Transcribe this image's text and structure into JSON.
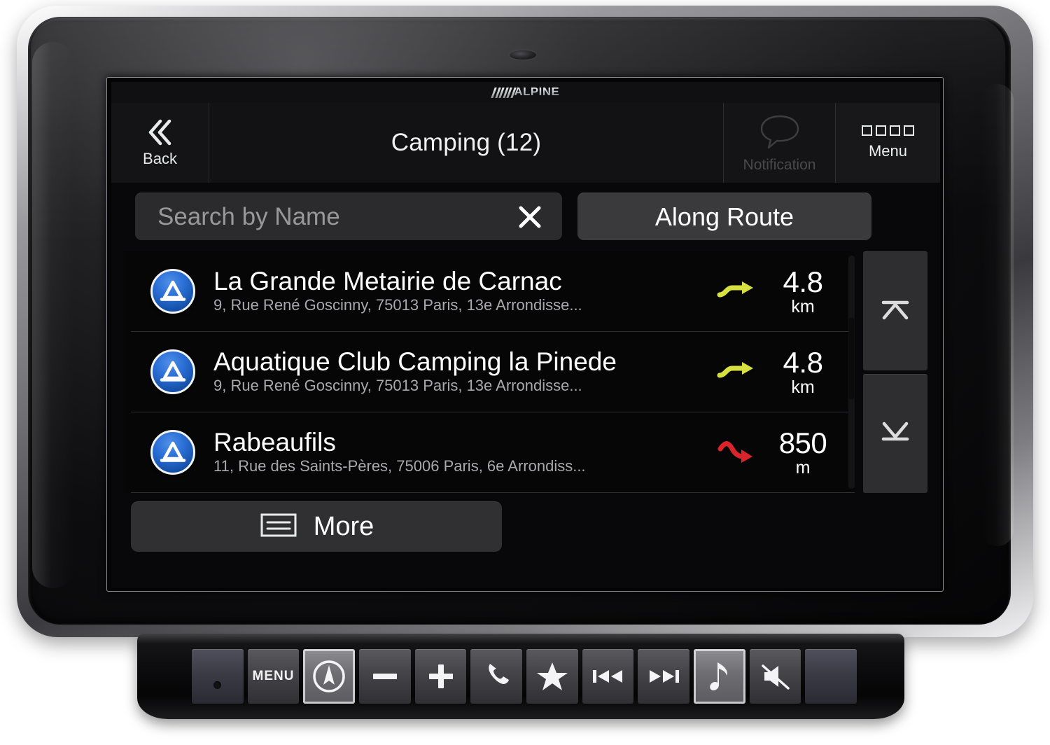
{
  "device": {
    "brand_logo": "ALPINE",
    "sensor": "ir-sensor"
  },
  "header": {
    "back_label": "Back",
    "back_icon": "double-chevron-left-icon",
    "title": "Camping (12)",
    "notification_label": "Notification",
    "notification_icon": "speech-bubble-icon",
    "notification_enabled": false,
    "menu_label": "Menu",
    "menu_icon": "four-squares-icon"
  },
  "search": {
    "placeholder": "Search by Name",
    "value": "",
    "clear_icon": "close-x-icon",
    "along_route_label": "Along Route"
  },
  "list": {
    "poi_icon": "camping-tent-icon",
    "rows": [
      {
        "name": "La Grande Metairie de Carnac",
        "address": "9, Rue René Goscinny, 75013 Paris, 13e Arrondisse...",
        "distance_value": "4.8",
        "distance_unit": "km",
        "direction_icon": "arrow-ahead-icon",
        "direction_color": "#d8e040"
      },
      {
        "name": "Aquatique Club Camping la Pinede",
        "address": "9, Rue René Goscinny, 75013 Paris, 13e Arrondisse...",
        "distance_value": "4.8",
        "distance_unit": "km",
        "direction_icon": "arrow-ahead-icon",
        "direction_color": "#d8e040"
      },
      {
        "name": "Rabeaufils",
        "address": "11, Rue des Saints-Pères, 75006 Paris, 6e Arrondiss...",
        "distance_value": "850",
        "distance_unit": "m",
        "direction_icon": "arrow-behind-icon",
        "direction_color": "#d8242a"
      }
    ]
  },
  "scroll": {
    "up_icon": "jump-to-top-icon",
    "down_icon": "jump-to-bottom-icon"
  },
  "footer": {
    "more_label": "More",
    "more_icon": "list-lines-icon"
  },
  "hardware_buttons": [
    {
      "name": "ir-sensor",
      "label": "",
      "icon": "ir-dot-icon",
      "lit": false,
      "style": "dark"
    },
    {
      "name": "menu",
      "label": "MENU",
      "icon": "",
      "lit": false,
      "style": "normal"
    },
    {
      "name": "navigation",
      "label": "",
      "icon": "nav-compass-icon",
      "lit": true,
      "style": "normal"
    },
    {
      "name": "volume-down",
      "label": "",
      "icon": "minus-icon",
      "lit": false,
      "style": "normal"
    },
    {
      "name": "volume-up",
      "label": "",
      "icon": "plus-icon",
      "lit": false,
      "style": "normal"
    },
    {
      "name": "phone",
      "label": "",
      "icon": "phone-icon",
      "lit": false,
      "style": "normal"
    },
    {
      "name": "favorite",
      "label": "",
      "icon": "star-icon",
      "lit": false,
      "style": "normal"
    },
    {
      "name": "previous-track",
      "label": "",
      "icon": "previous-track-icon",
      "lit": false,
      "style": "normal"
    },
    {
      "name": "next-track",
      "label": "",
      "icon": "next-track-icon",
      "lit": false,
      "style": "normal"
    },
    {
      "name": "audio",
      "label": "",
      "icon": "music-note-icon",
      "lit": true,
      "style": "normal"
    },
    {
      "name": "mute",
      "label": "",
      "icon": "mute-speaker-icon",
      "lit": false,
      "style": "normal"
    },
    {
      "name": "blank",
      "label": "",
      "icon": "",
      "lit": false,
      "style": "dark"
    }
  ],
  "colors": {
    "screen_bg": "#08080a",
    "header_bg": "#151517",
    "accent_blue": "#2b6fd6",
    "arrow_ahead": "#d8e040",
    "arrow_behind": "#d8242a",
    "text_primary": "#ffffff",
    "text_secondary": "#a9a9ad",
    "text_disabled": "#4a4a4e"
  }
}
